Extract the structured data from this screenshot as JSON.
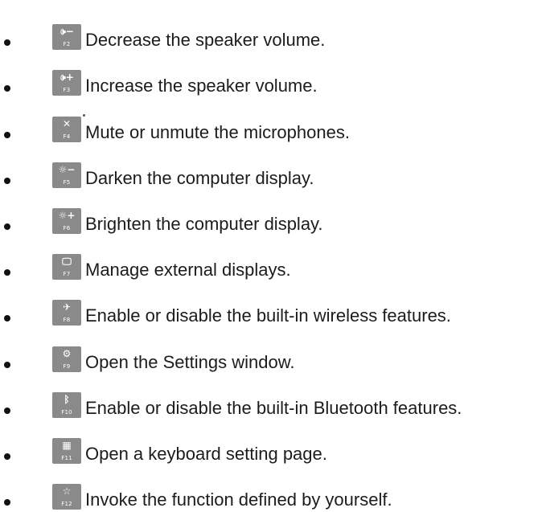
{
  "items": [
    {
      "glyph": "🕩−",
      "key": "F2",
      "text": "Decrease the speaker volume.",
      "icon": "speaker-volume-down-icon"
    },
    {
      "glyph": "🕩+",
      "key": "F3",
      "text": "Increase the speaker volume.",
      "icon": "speaker-volume-up-icon"
    },
    {
      "glyph": "✕",
      "key": "F4",
      "text": "Mute or unmute the microphones.",
      "icon": "microphone-mute-icon"
    },
    {
      "glyph": "☼−",
      "key": "F5",
      "text": "Darken the computer display.",
      "icon": "brightness-down-icon"
    },
    {
      "glyph": "☼+",
      "key": "F6",
      "text": "Brighten the computer display.",
      "icon": "brightness-up-icon"
    },
    {
      "glyph": "🖵",
      "key": "F7",
      "text": "Manage external displays.",
      "icon": "external-display-icon"
    },
    {
      "glyph": "✈",
      "key": "F8",
      "text": "Enable or disable the built-in wireless features.",
      "icon": "wireless-icon"
    },
    {
      "glyph": "⚙",
      "key": "F9",
      "text": "Open the Settings window.",
      "icon": "settings-gear-icon"
    },
    {
      "glyph": "ᛒ",
      "key": "F10",
      "text": "Enable or disable the built-in Bluetooth features.",
      "icon": "bluetooth-icon"
    },
    {
      "glyph": "▦",
      "key": "F11",
      "text": "Open a keyboard setting page.",
      "icon": "keyboard-icon"
    },
    {
      "glyph": "☆",
      "key": "F12",
      "text": "Invoke the function defined by yourself.",
      "icon": "star-icon"
    }
  ],
  "colors": {
    "keycap": "#8a8a8a",
    "text": "#1c1c1c",
    "bullet": "#111111"
  }
}
